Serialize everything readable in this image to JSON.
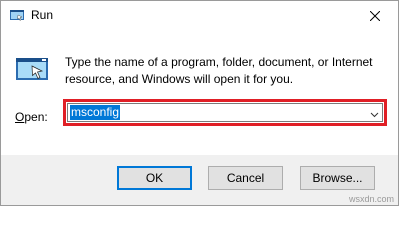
{
  "window": {
    "title": "Run",
    "icons": {
      "app": "run-app-icon",
      "close": "close-icon",
      "run_large": "run-large-icon",
      "dropdown": "chevron-down-icon"
    }
  },
  "main": {
    "description": "Type the name of a program, folder, document, or Internet resource, and Windows will open it for you.",
    "open_label_prefix": "O",
    "open_label_rest": "pen:",
    "input_value": "msconfig"
  },
  "buttons": {
    "ok": "OK",
    "cancel": "Cancel",
    "browse": "Browse..."
  },
  "watermark": "wsxdn.com",
  "colors": {
    "highlight": "#e01f26",
    "selection": "#0078d7",
    "footer_bg": "#f0f0f0"
  }
}
